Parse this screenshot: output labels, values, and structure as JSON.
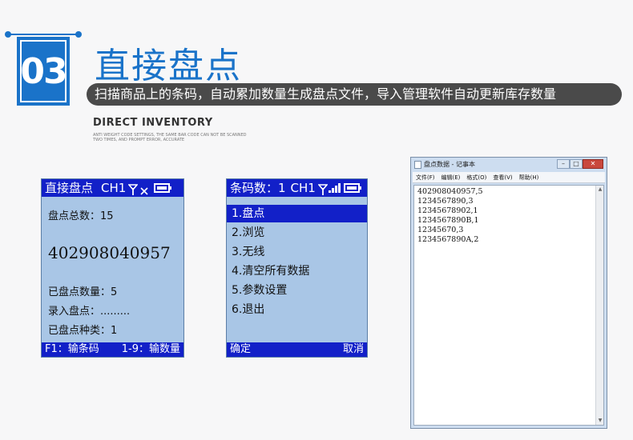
{
  "header": {
    "badge_number": "03",
    "title": "直接盘点",
    "subtitle": "扫描商品上的条码，自动累加数量生成盘点文件，导入管理软件自动更新库存数量",
    "eng_title": "DIRECT INVENTORY",
    "eng_desc_line1": "ANTI WEIGHT CODE SETTINGS, THE SAME BAR CODE CAN NOT BE SCANNED",
    "eng_desc_line2": "TWO TIMES, AND PROMPT ERROR, ACCURATE"
  },
  "screen1": {
    "title": "直接盘点",
    "channel": "CH1",
    "total_label": "盘点总数：15",
    "barcode": "402908040957",
    "count_label": "已盘点数量：5",
    "input_label": "录入盘点：.........",
    "kinds_label": "已盘点种类：1",
    "footer_left": "F1：输条码",
    "footer_right": "1-9：输数量",
    "icons": [
      "antenna-icon",
      "no-signal-icon",
      "battery-icon"
    ]
  },
  "screen2": {
    "title": "条码数：1",
    "channel": "CH1",
    "menu": [
      {
        "label": "1.盘点",
        "selected": true
      },
      {
        "label": "2.浏览",
        "selected": false
      },
      {
        "label": "3.无线",
        "selected": false
      },
      {
        "label": "4.清空所有数据",
        "selected": false
      },
      {
        "label": "5.参数设置",
        "selected": false
      },
      {
        "label": "6.退出",
        "selected": false
      }
    ],
    "footer_left": "确定",
    "footer_right": "取消",
    "icons": [
      "antenna-icon",
      "signal-bars-icon",
      "battery-icon"
    ]
  },
  "notepad": {
    "title": "盘点数据 - 记事本",
    "menu": [
      "文件(F)",
      "编辑(E)",
      "格式(O)",
      "查看(V)",
      "帮助(H)"
    ],
    "lines": [
      "402908040957,5",
      "1234567890,3",
      "12345678902,1",
      "1234567890B,1",
      "12345670,3",
      "1234567890A,2"
    ],
    "buttons": [
      "minimize",
      "maximize",
      "close"
    ]
  },
  "colors": {
    "accent_blue": "#1a73c9",
    "screen_bg": "#a9c6e6",
    "screen_bar": "#1220c8",
    "subtitle_bg": "#4a4a4a"
  }
}
